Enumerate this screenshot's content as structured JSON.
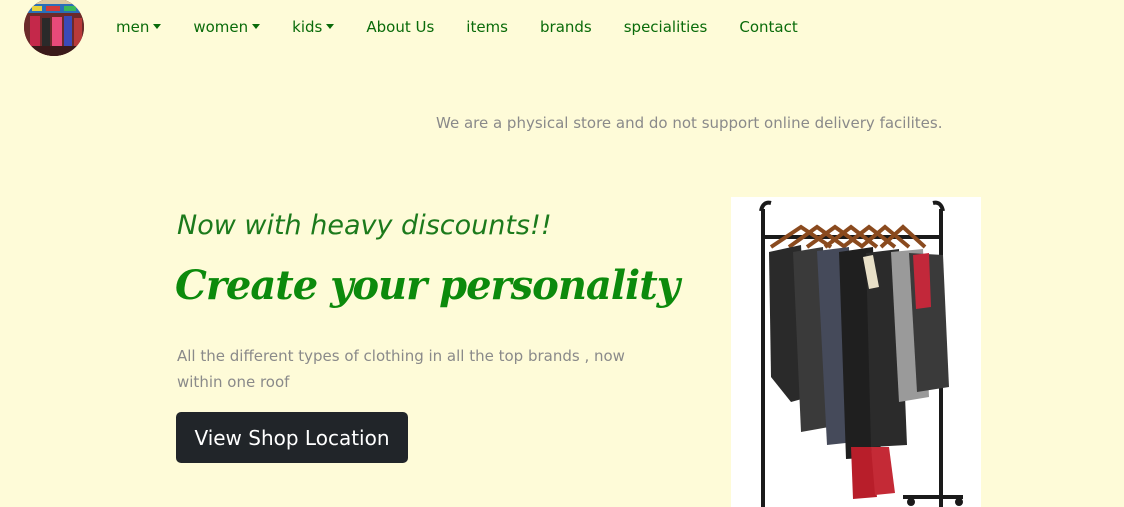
{
  "nav": {
    "items": [
      {
        "label": "men",
        "dropdown": true
      },
      {
        "label": "women",
        "dropdown": true
      },
      {
        "label": "kids",
        "dropdown": true
      },
      {
        "label": "About Us",
        "dropdown": false
      },
      {
        "label": "items",
        "dropdown": false
      },
      {
        "label": "brands",
        "dropdown": false
      },
      {
        "label": "specialities",
        "dropdown": false
      },
      {
        "label": "Contact",
        "dropdown": false
      }
    ]
  },
  "notice": {
    "text": "We are a physical store and do not support online delivery facilites."
  },
  "hero": {
    "tagline": "Now with heavy discounts!!",
    "headline": "Create your personality",
    "description": "All the different types of clothing in all the top brands , now within one roof",
    "cta_label": "View Shop Location"
  },
  "colors": {
    "background": "#fefbd8",
    "nav_text": "#0a6b0a",
    "accent_green": "#0c8a0c",
    "muted_text": "#8a8a8a",
    "button_bg": "#212529",
    "button_text": "#ffffff"
  },
  "icons": {
    "dropdown": "caret-down-icon"
  }
}
